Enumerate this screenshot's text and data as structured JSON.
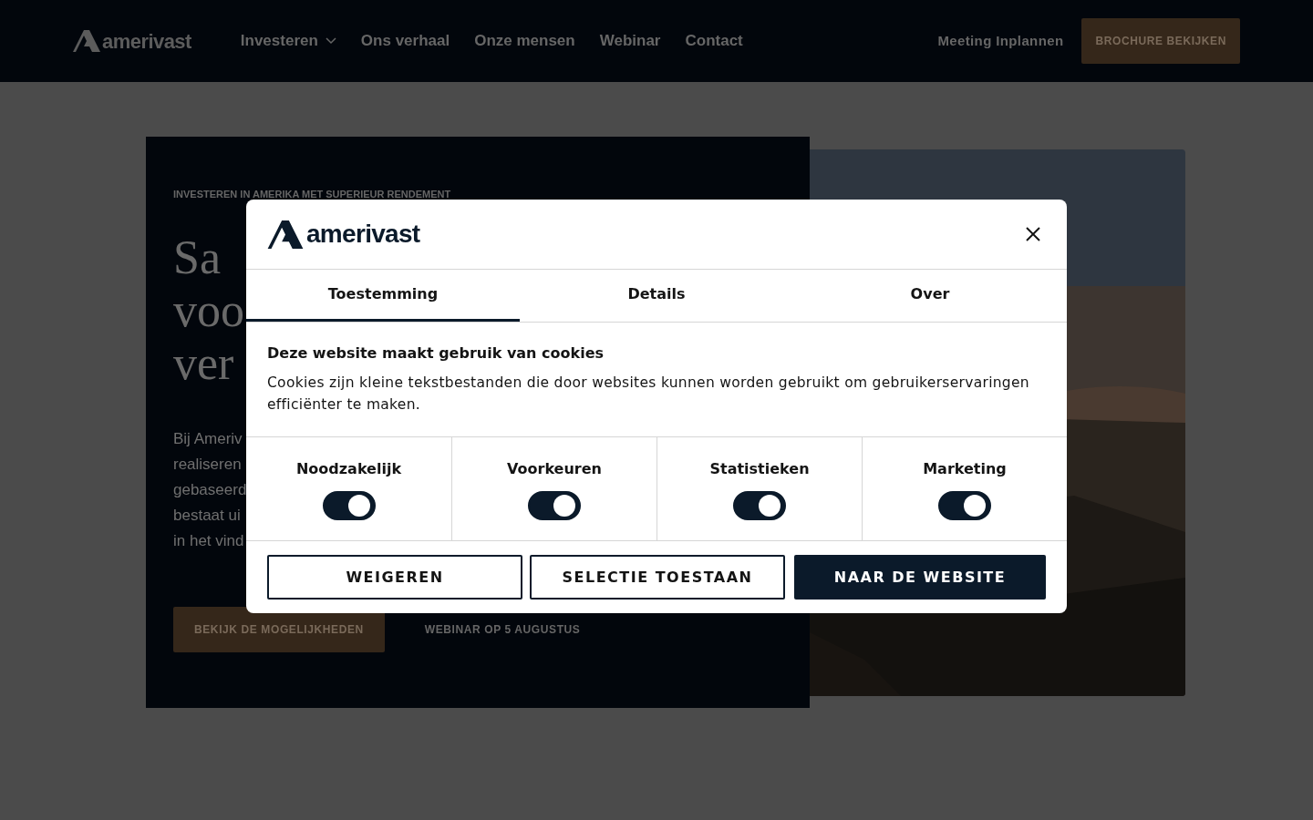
{
  "header": {
    "logo": "amerivast",
    "nav": [
      {
        "label": "Investeren",
        "dropdown": true
      },
      {
        "label": "Ons verhaal",
        "dropdown": false
      },
      {
        "label": "Onze mensen",
        "dropdown": false
      },
      {
        "label": "Webinar",
        "dropdown": false
      },
      {
        "label": "Contact",
        "dropdown": false
      }
    ],
    "meeting_link": "Meeting Inplannen",
    "brochure_button": "BROCHURE BEKIJKEN"
  },
  "hero": {
    "eyebrow": "INVESTEREN IN AMERIKA MET SUPERIEUR RENDEMENT",
    "heading_lines": [
      "Sa",
      "voo",
      "ver"
    ],
    "body_lines": [
      "Bij Ameriv",
      "realiseren",
      "gebaseerd",
      "bestaat ui",
      "in het vind"
    ],
    "primary_button": "BEKIJK DE MOGELIJKHEDEN",
    "secondary_link": "WEBINAR OP 5 AUGUSTUS",
    "image": {
      "kind": "picture"
    }
  },
  "cookie_dialog": {
    "logo": "amerivast",
    "tabs": [
      {
        "label": "Toestemming",
        "selected": true
      },
      {
        "label": "Details",
        "selected": false
      },
      {
        "label": "Over",
        "selected": false
      }
    ],
    "title": "Deze website maakt gebruik van cookies",
    "text": "Cookies zijn kleine tekstbestanden die door websites kunnen worden gebruikt om gebruikerservaringen efficiënter te maken.",
    "categories": [
      {
        "label": "Noodzakelijk",
        "checked": true
      },
      {
        "label": "Voorkeuren",
        "checked": true
      },
      {
        "label": "Statistieken",
        "checked": true
      },
      {
        "label": "Marketing",
        "checked": true
      }
    ],
    "buttons": [
      {
        "label": "WEIGEREN",
        "kind": "outline"
      },
      {
        "label": "SELECTIE TOESTAAN",
        "kind": "outline"
      },
      {
        "label": "NAAR DE WEBSITE",
        "kind": "solid"
      }
    ]
  }
}
